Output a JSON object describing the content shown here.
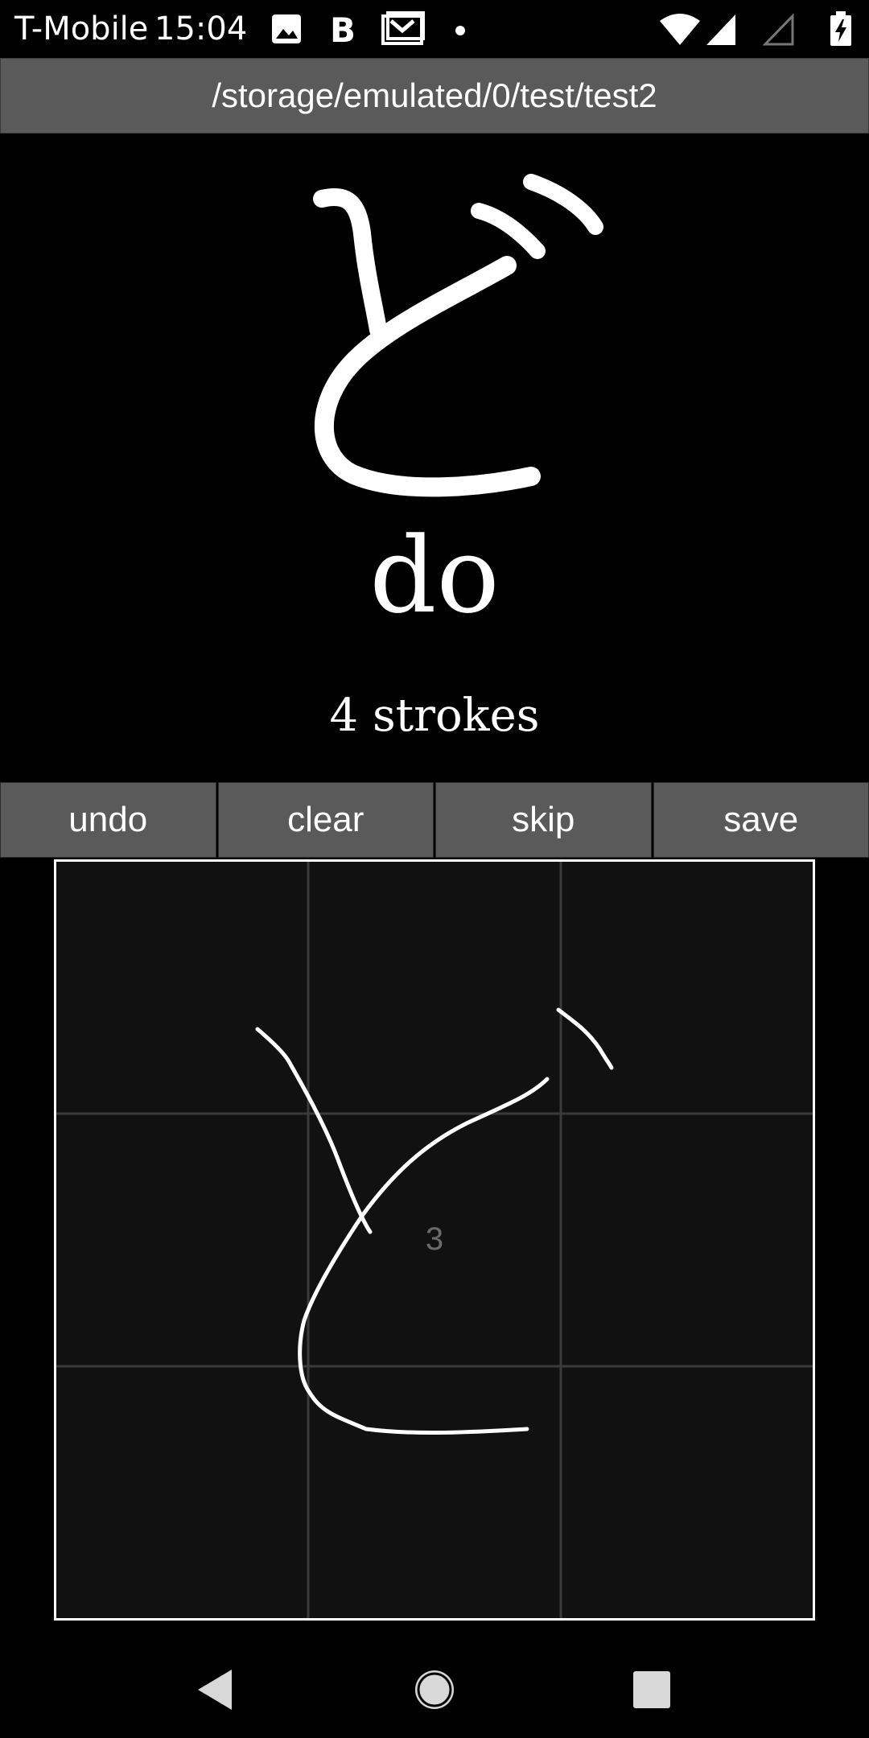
{
  "status_bar": {
    "carrier": "T-Mobile",
    "time": "15:04",
    "notification_icons": [
      "image-icon",
      "bold-b-icon",
      "mail-icon",
      "dot-icon"
    ],
    "system_icons": [
      "wifi-icon",
      "signal-icon",
      "signal-empty-icon",
      "battery-charging-icon"
    ]
  },
  "path_bar": {
    "path": "/storage/emulated/0/test/test2"
  },
  "character": {
    "kana": "ど",
    "romaji": "do",
    "stroke_count_label": "4 strokes"
  },
  "buttons": {
    "undo": "undo",
    "clear": "clear",
    "skip": "skip",
    "save": "save"
  },
  "canvas": {
    "current_stroke_number": "3",
    "grid_divisions": 3,
    "background_color": "#111111",
    "stroke_color": "#ffffff",
    "grid_color": "#3a3a3a"
  },
  "nav_bar": {
    "icons": [
      "back-icon",
      "home-icon",
      "recents-icon"
    ]
  },
  "colors": {
    "bar_gray": "#5a5a5a",
    "background": "#000000",
    "text": "#ffffff"
  }
}
